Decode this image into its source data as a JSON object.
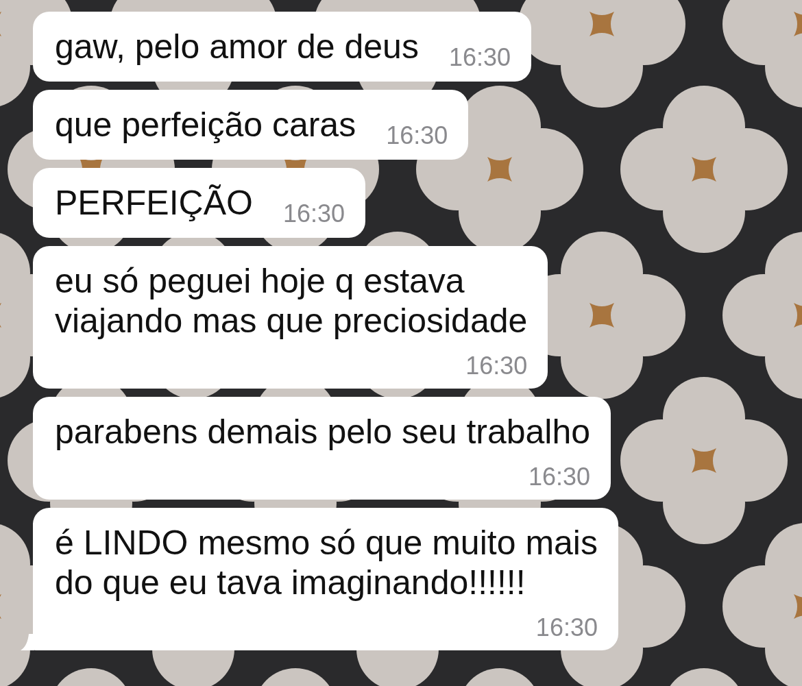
{
  "messages": [
    {
      "lines": [
        "gaw, pelo amor de deus"
      ],
      "time": "16:30",
      "kind": "inline",
      "tail": false
    },
    {
      "lines": [
        "que perfeição caras"
      ],
      "time": "16:30",
      "kind": "inline",
      "tail": false
    },
    {
      "lines": [
        "PERFEIÇÃO"
      ],
      "time": "16:30",
      "kind": "inline",
      "tail": false
    },
    {
      "lines": [
        "eu só peguei hoje q estava",
        "viajando mas que preciosidade"
      ],
      "time": "16:30",
      "kind": "below",
      "tail": false
    },
    {
      "lines": [
        "parabens demais pelo seu trabalho"
      ],
      "time": "16:30",
      "kind": "below",
      "tail": false
    },
    {
      "lines": [
        "é LINDO mesmo só que muito mais",
        "do que eu tava imaginando!!!!!!"
      ],
      "time": "16:30",
      "kind": "below",
      "tail": true
    }
  ]
}
